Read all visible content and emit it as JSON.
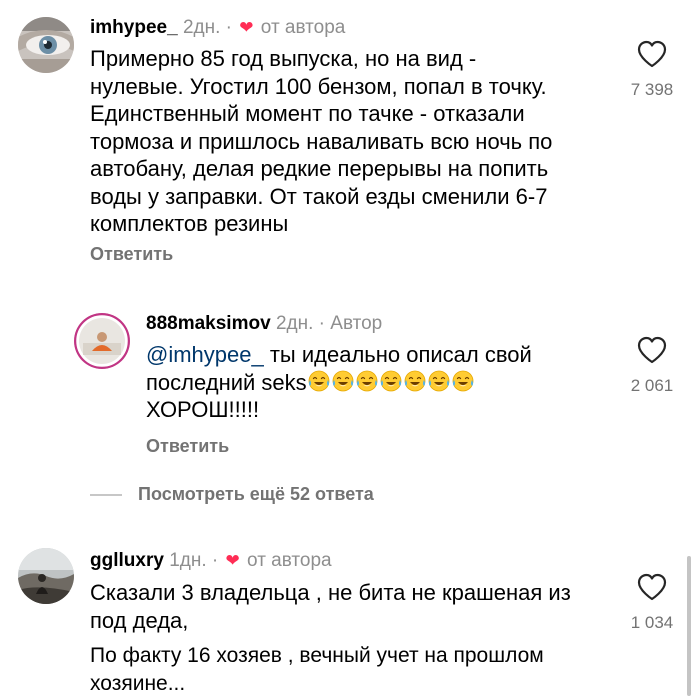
{
  "comments": [
    {
      "username": "imhypee_",
      "age": "2дн.",
      "separator": "·",
      "author_badge": "от автора",
      "lines": [
        "Примерно 85 год выпуска, но на вид -",
        "нулевые. Угостил 100 бензом, попал в точку.",
        "Единственный момент по тачке - отказали",
        "тормоза и пришлось наваливать всю ночь по",
        "автобану, делая редкие перерывы на попить",
        "воды у заправки. От такой езды сменили 6-7",
        "комплектов резины"
      ],
      "likes": "7 398",
      "reply_label": "Ответить"
    },
    {
      "username": "888maksimov",
      "age": "2дн.",
      "separator": "·",
      "author_badge": "Автор",
      "mention": "@imhypee_",
      "line1_rest": " ты идеально описал свой",
      "line2": "последний seks",
      "emoji_count": 7,
      "line3": "ХОРОШ!!!!!",
      "likes": "2 061",
      "reply_label": "Ответить"
    },
    {
      "username": "gglluxry",
      "age": "1дн.",
      "separator": "·",
      "author_badge": "от автора",
      "lines": [
        "Сказали 3  владельца , не бита не крашеная из",
        "под деда,"
      ],
      "lines_b": [
        "По факту 16 хозяев , вечный учет на прошлом",
        "хозяине..."
      ],
      "likes": "1 034"
    }
  ],
  "view_more": "Посмотреть ещё 52 ответа",
  "icons": {
    "like": "heart-outline-icon",
    "author_like": "red-heart-icon",
    "laugh": "tears-of-joy-emoji"
  },
  "colors": {
    "meta": "#8e8e8e",
    "mention": "#00376b",
    "heart": "#ff2d55"
  }
}
